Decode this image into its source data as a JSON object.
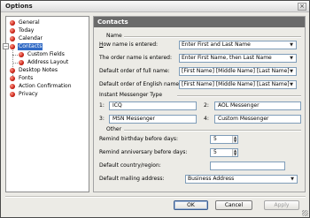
{
  "window": {
    "title": "Options",
    "close_glyph": "×"
  },
  "tree": {
    "items": [
      {
        "label": "General"
      },
      {
        "label": "Today"
      },
      {
        "label": "Calendar"
      },
      {
        "label": "Contacts",
        "selected": true,
        "expanded": true
      },
      {
        "label": "Custom Fields"
      },
      {
        "label": "Address Layout"
      },
      {
        "label": "Desktop Notes"
      },
      {
        "label": "Fonts"
      },
      {
        "label": "Action Confirmation"
      },
      {
        "label": "Privacy"
      }
    ],
    "collapse_glyph": "−"
  },
  "panel": {
    "header": "Contacts",
    "name_group": {
      "title": "Name",
      "how_label": "How name is entered:",
      "how_value": "Enter First and Last Name",
      "order_label": "The order name is entered:",
      "order_value": "Enter First Name, then Last Name",
      "full_label": "Default order of full name:",
      "full_value": "[First Name] [Middle Name] [Last Name]",
      "english_label": "Default order of English name:",
      "english_value": "[First Name] [Middle Name] [Last Name]"
    },
    "im_group": {
      "title": "Instant Messenger Type",
      "fields": [
        {
          "num": "1:",
          "value": "ICQ"
        },
        {
          "num": "2:",
          "value": "AOL Messenger"
        },
        {
          "num": "3:",
          "value": "MSN Messenger"
        },
        {
          "num": "4:",
          "value": "Custom Messenger"
        }
      ]
    },
    "other_group": {
      "title": "Other",
      "birthday_label": "Remind birthday before days:",
      "birthday_value": "5",
      "anniversary_label": "Remind anniversary before days:",
      "anniversary_value": "5",
      "country_label": "Default country/region:",
      "country_value": "",
      "mailing_label": "Default mailing address:",
      "mailing_value": "Business Address"
    }
  },
  "buttons": {
    "ok": "OK",
    "cancel": "Cancel",
    "apply": "Apply"
  },
  "icons": {
    "dropdown": "▼",
    "spin_up": "▲",
    "spin_down": "▼"
  }
}
